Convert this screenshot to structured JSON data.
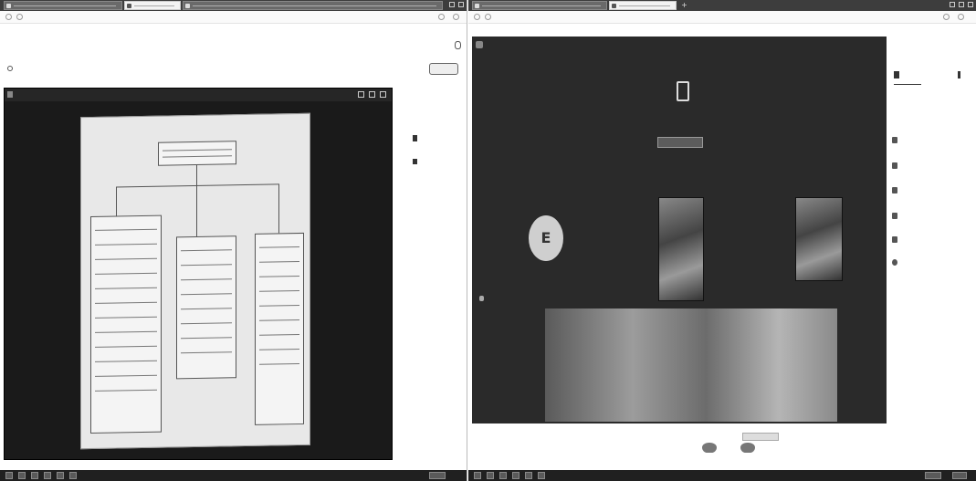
{
  "left_window": {
    "tabs": [
      {
        "title": "",
        "active": false
      },
      {
        "title": "",
        "active": true
      },
      {
        "title": "",
        "active": false
      }
    ],
    "address": "",
    "header_label": "",
    "sub_label": "",
    "share_tile_title": "",
    "right_panel_items": [
      "",
      "",
      "",
      "",
      ""
    ]
  },
  "right_window": {
    "tabs": [
      {
        "title": "",
        "active": false
      },
      {
        "title": "",
        "active": true
      }
    ],
    "address": "",
    "meeting_title": "",
    "status_text": "",
    "status_button": "",
    "avatar_letter": "E",
    "name_tags": [
      "",
      "",
      "",
      ""
    ],
    "side_header": "",
    "side_items": [
      "",
      "",
      "",
      "",
      "",
      ""
    ],
    "footer_left": "",
    "footer_mid": ""
  },
  "colors": {
    "tab_strip": "#3d3d3d",
    "meeting_bg": "#2a2a2a",
    "taskbar": "#202020"
  }
}
